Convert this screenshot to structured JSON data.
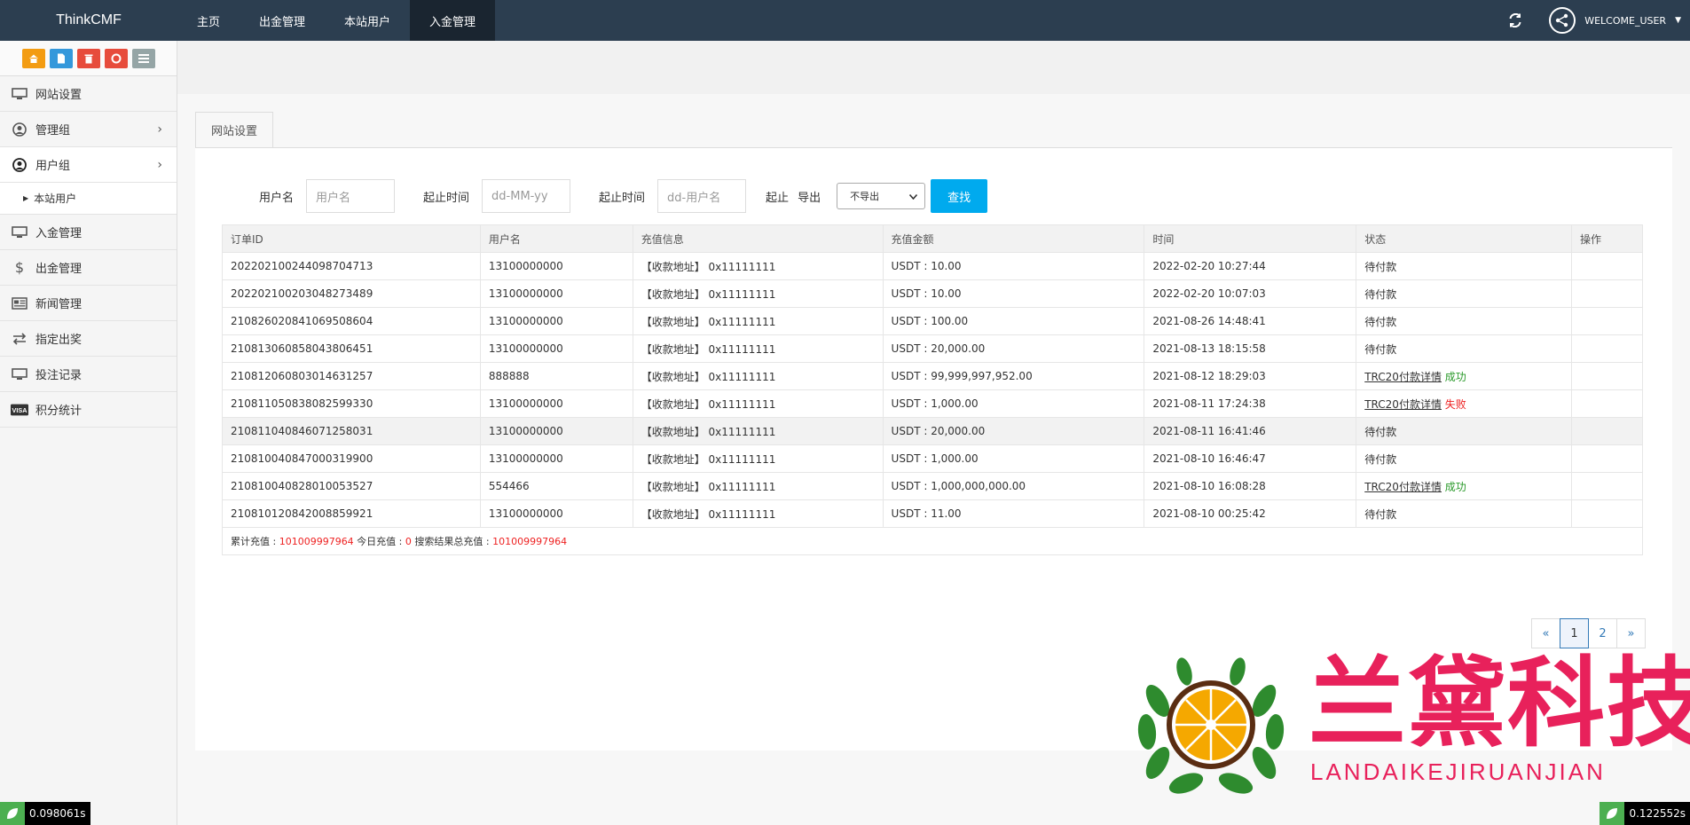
{
  "brand": "ThinkCMF",
  "nav": [
    "主页",
    "出金管理",
    "本站用户",
    "入金管理"
  ],
  "user": {
    "welcome": "WELCOME_USER"
  },
  "sidebar": {
    "items": [
      {
        "label": "网站设置",
        "icon": "monitor-icon"
      },
      {
        "label": "管理组",
        "icon": "user-circle-icon",
        "arrow": "›"
      },
      {
        "label": "用户组",
        "icon": "user-icon",
        "arrow": "›"
      },
      {
        "label": "入金管理",
        "icon": "monitor-icon"
      },
      {
        "label": "出金管理",
        "icon": "dollar-icon"
      },
      {
        "label": "新闻管理",
        "icon": "newspaper-icon"
      },
      {
        "label": "指定出奖",
        "icon": "exchange-icon"
      },
      {
        "label": "投注记录",
        "icon": "monitor-icon"
      },
      {
        "label": "积分统计",
        "icon": "visa-icon"
      }
    ],
    "submenu": "本站用户"
  },
  "tab": "网站设置",
  "filter": {
    "username_label": "用户名",
    "username_placeholder": "用户名",
    "start_label": "起止时间",
    "start_placeholder": "dd-MM-yy",
    "end_label": "起止时间",
    "end_placeholder": "dd-用户名",
    "cut_label": "起止",
    "export_label": "导出",
    "export_value": "不导出",
    "search_button": "查找"
  },
  "table": {
    "headers": [
      "订单ID",
      "用户名",
      "充值信息",
      "充值金额",
      "时间",
      "状态",
      "操作"
    ],
    "rows": [
      {
        "id": "202202100244098704713",
        "user": "13100000000",
        "info": "【收款地址】 0x11111111",
        "amount": "USDT : 10.00",
        "time": "2022-02-20 10:27:44",
        "status": "待付款",
        "link": "",
        "result": "",
        "result_type": ""
      },
      {
        "id": "202202100203048273489",
        "user": "13100000000",
        "info": "【收款地址】 0x11111111",
        "amount": "USDT : 10.00",
        "time": "2022-02-20 10:07:03",
        "status": "待付款",
        "link": "",
        "result": "",
        "result_type": ""
      },
      {
        "id": "210826020841069508604",
        "user": "13100000000",
        "info": "【收款地址】 0x11111111",
        "amount": "USDT : 100.00",
        "time": "2021-08-26 14:48:41",
        "status": "待付款",
        "link": "",
        "result": "",
        "result_type": ""
      },
      {
        "id": "210813060858043806451",
        "user": "13100000000",
        "info": "【收款地址】 0x11111111",
        "amount": "USDT : 20,000.00",
        "time": "2021-08-13 18:15:58",
        "status": "待付款",
        "link": "",
        "result": "",
        "result_type": ""
      },
      {
        "id": "210812060803014631257",
        "user": "888888",
        "info": "【收款地址】 0x11111111",
        "amount": "USDT : 99,999,997,952.00",
        "time": "2021-08-12 18:29:03",
        "status": "",
        "link": "TRC20付款详情",
        "result": "成功",
        "result_type": "ok"
      },
      {
        "id": "210811050838082599330",
        "user": "13100000000",
        "info": "【收款地址】 0x11111111",
        "amount": "USDT : 1,000.00",
        "time": "2021-08-11 17:24:38",
        "status": "",
        "link": "TRC20付款详情",
        "result": "失败",
        "result_type": "fail"
      },
      {
        "id": "210811040846071258031",
        "user": "13100000000",
        "info": "【收款地址】 0x11111111",
        "amount": "USDT : 20,000.00",
        "time": "2021-08-11 16:41:46",
        "status": "待付款",
        "link": "",
        "result": "",
        "result_type": ""
      },
      {
        "id": "210810040847000319900",
        "user": "13100000000",
        "info": "【收款地址】 0x11111111",
        "amount": "USDT : 1,000.00",
        "time": "2021-08-10 16:46:47",
        "status": "待付款",
        "link": "",
        "result": "",
        "result_type": ""
      },
      {
        "id": "210810040828010053527",
        "user": "554466",
        "info": "【收款地址】 0x11111111",
        "amount": "USDT : 1,000,000,000.00",
        "time": "2021-08-10 16:08:28",
        "status": "",
        "link": "TRC20付款详情",
        "result": "成功",
        "result_type": "ok"
      },
      {
        "id": "210810120842008859921",
        "user": "13100000000",
        "info": "【收款地址】 0x11111111",
        "amount": "USDT : 11.00",
        "time": "2021-08-10 00:25:42",
        "status": "待付款",
        "link": "",
        "result": "",
        "result_type": ""
      }
    ],
    "summary": {
      "total_label": "累计充值 : ",
      "total_value": "101009997964",
      "today_label": " 今日充值 : ",
      "today_value": "0",
      "search_label": " 搜索结果总充值 : ",
      "search_value": "101009997964"
    }
  },
  "pager": [
    "«",
    "1",
    "2",
    "»"
  ],
  "watermark": {
    "title": "兰黛科技",
    "subtitle": "LANDAIKEJIRUANJIAN"
  },
  "timers": {
    "left": "0.098061s",
    "right": "0.122552s"
  }
}
